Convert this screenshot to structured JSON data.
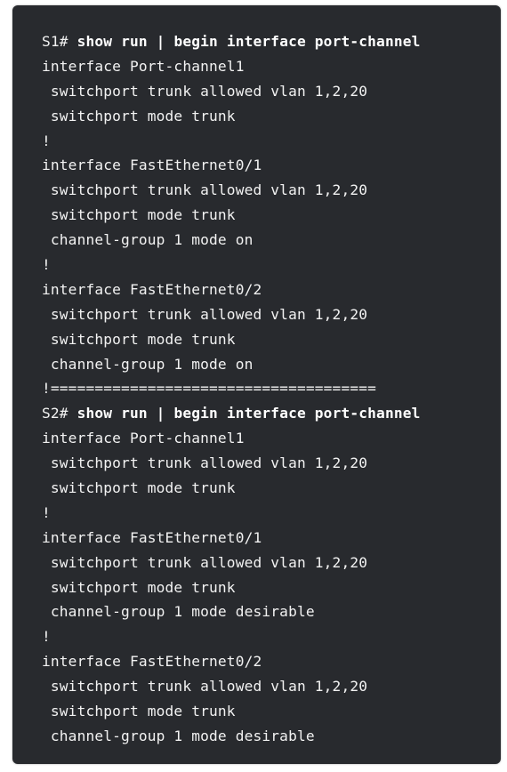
{
  "terminal": {
    "lines": [
      {
        "prompt": "S1# ",
        "command": "show run | begin interface port-channel"
      },
      {
        "text": "interface Port-channel1"
      },
      {
        "text": " switchport trunk allowed vlan 1,2,20"
      },
      {
        "text": " switchport mode trunk"
      },
      {
        "text": "!"
      },
      {
        "text": "interface FastEthernet0/1"
      },
      {
        "text": " switchport trunk allowed vlan 1,2,20"
      },
      {
        "text": " switchport mode trunk"
      },
      {
        "text": " channel-group 1 mode on"
      },
      {
        "text": "!"
      },
      {
        "text": "interface FastEthernet0/2"
      },
      {
        "text": " switchport trunk allowed vlan 1,2,20"
      },
      {
        "text": " switchport mode trunk"
      },
      {
        "text": " channel-group 1 mode on"
      },
      {
        "text": "!====================================="
      },
      {
        "prompt": "S2# ",
        "command": "show run | begin interface port-channel"
      },
      {
        "text": "interface Port-channel1"
      },
      {
        "text": " switchport trunk allowed vlan 1,2,20"
      },
      {
        "text": " switchport mode trunk"
      },
      {
        "text": "!"
      },
      {
        "text": "interface FastEthernet0/1"
      },
      {
        "text": " switchport trunk allowed vlan 1,2,20"
      },
      {
        "text": " switchport mode trunk"
      },
      {
        "text": " channel-group 1 mode desirable"
      },
      {
        "text": "!"
      },
      {
        "text": "interface FastEthernet0/2"
      },
      {
        "text": " switchport trunk allowed vlan 1,2,20"
      },
      {
        "text": " switchport mode trunk"
      },
      {
        "text": " channel-group 1 mode desirable"
      }
    ]
  }
}
